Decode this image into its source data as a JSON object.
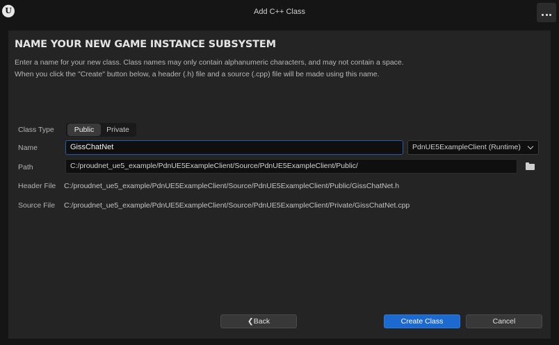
{
  "window": {
    "title": "Add C++ Class",
    "logo": "U",
    "more_icon": "more-dots-icon"
  },
  "header": {
    "title": "NAME YOUR NEW GAME INSTANCE SUBSYSTEM",
    "description_line1": "Enter a name for your new class. Class names may only contain alphanumeric characters, and may not contain a space.",
    "description_line2": "When you click the \"Create\" button below, a header (.h) file and a source (.cpp) file will be made using this name."
  },
  "form": {
    "class_type_label": "Class Type",
    "class_type_options": [
      "Public",
      "Private"
    ],
    "class_type_selected": "Public",
    "name_label": "Name",
    "name_value": "GissChatNet",
    "module_value": "PdnUE5ExampleClient (Runtime)",
    "path_label": "Path",
    "path_value": "C:/proudnet_ue5_example/PdnUE5ExampleClient/Source/PdnUE5ExampleClient/Public/",
    "header_file_label": "Header File",
    "header_file_value": "C:/proudnet_ue5_example/PdnUE5ExampleClient/Source/PdnUE5ExampleClient/Public/GissChatNet.h",
    "source_file_label": "Source File",
    "source_file_value": "C:/proudnet_ue5_example/PdnUE5ExampleClient/Source/PdnUE5ExampleClient/Private/GissChatNet.cpp"
  },
  "footer": {
    "back_label": "❮Back",
    "create_label": "Create Class",
    "cancel_label": "Cancel"
  },
  "colors": {
    "background": "#151515",
    "panel": "#242424",
    "accent": "#1c6ad0",
    "input_focus_border": "#2a5aa8"
  }
}
